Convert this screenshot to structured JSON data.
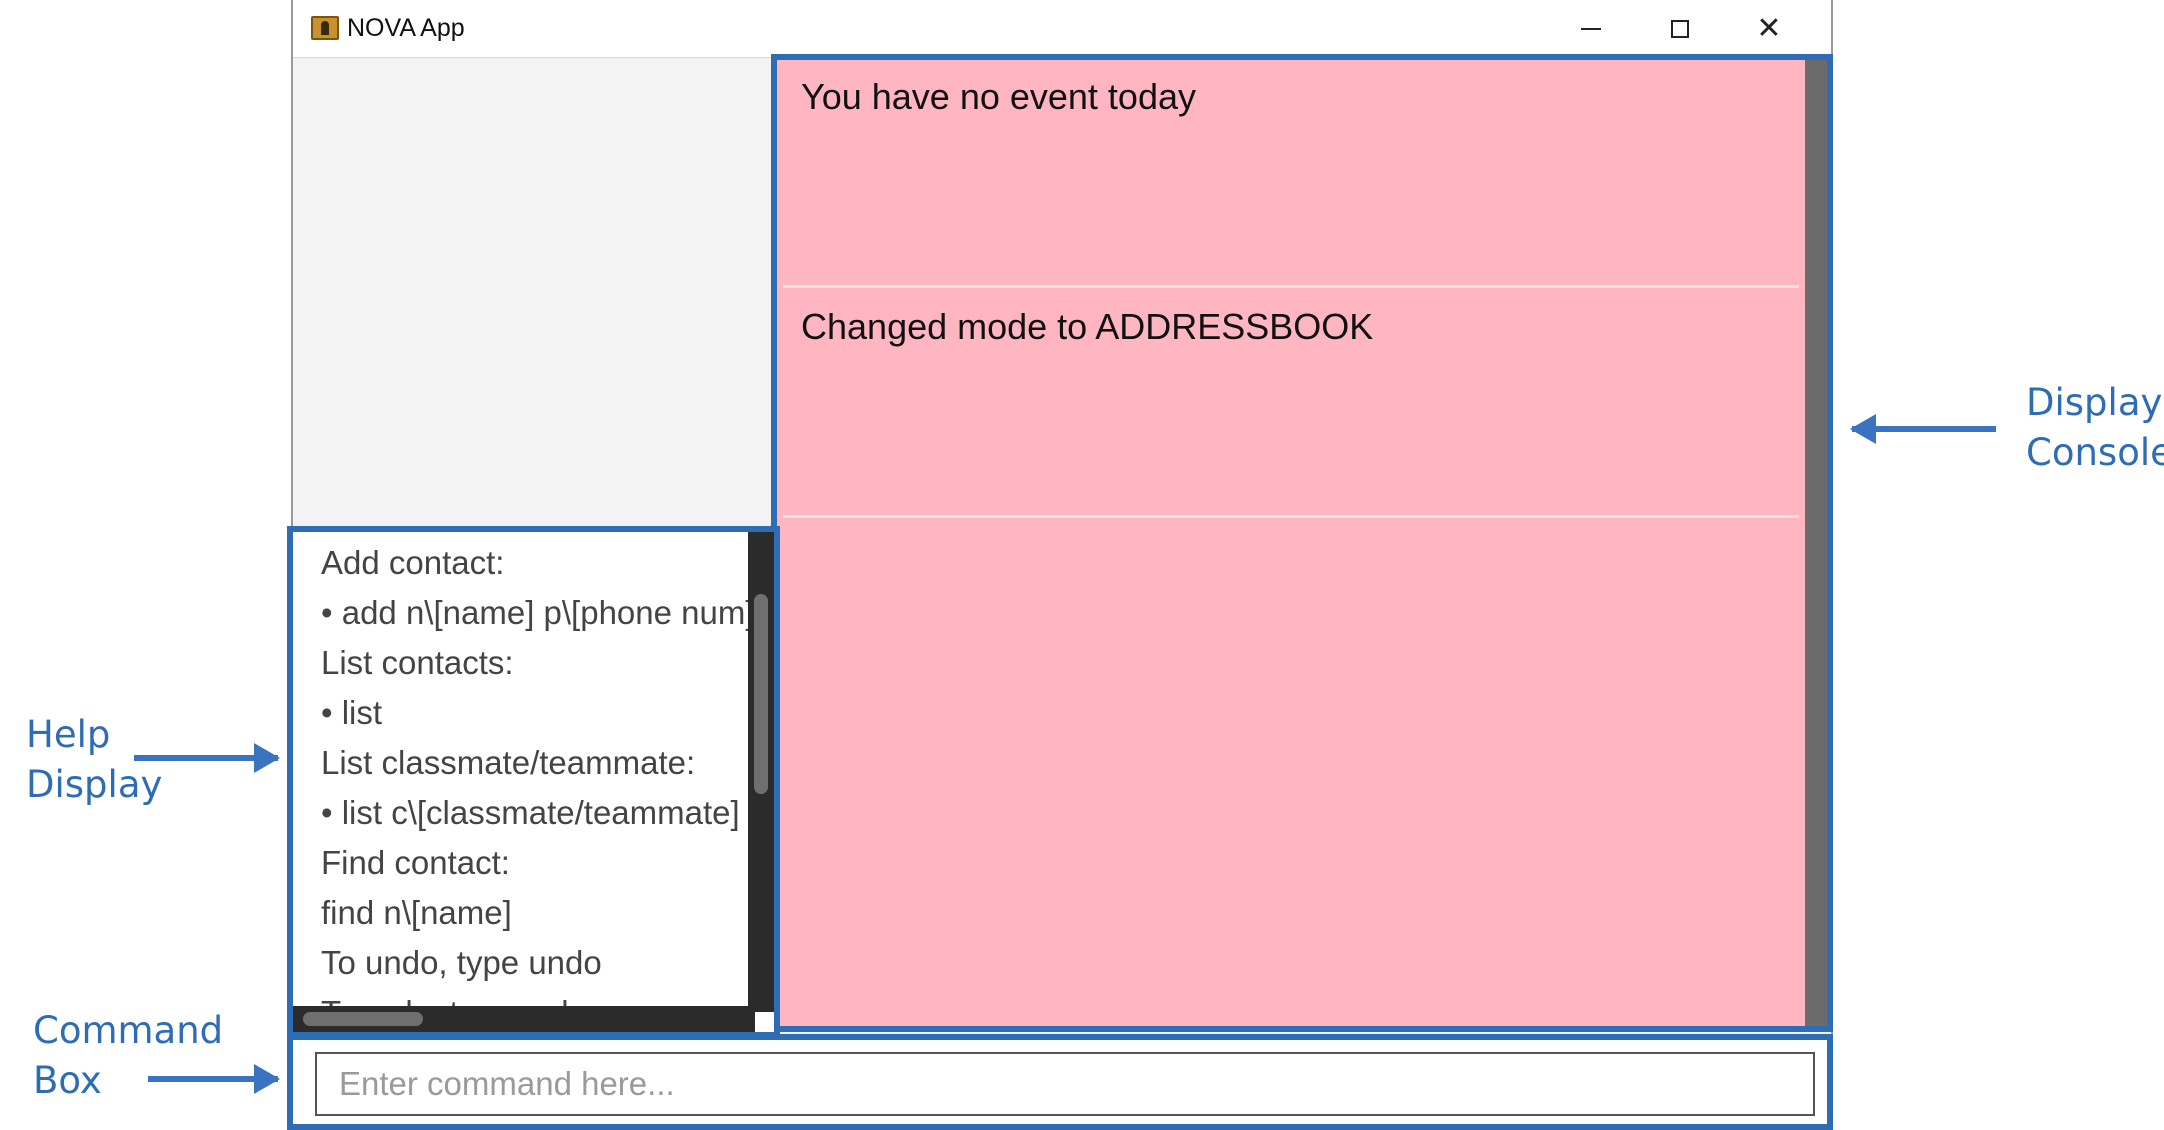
{
  "window": {
    "title": "NOVA App",
    "icon": "address-book-icon",
    "controls": [
      "minimize-icon",
      "maximize-icon",
      "close-icon"
    ]
  },
  "console": {
    "cards": [
      "You have no event today",
      "Changed mode to ADDRESSBOOK"
    ],
    "background": "#ffb6c1"
  },
  "help": {
    "lines": [
      "Add contact:",
      "• add n\\[name] p\\[phone num]",
      "List contacts:",
      "• list",
      "List classmate/teammate:",
      "• list c\\[classmate/teammate]",
      "Find contact:",
      "find n\\[name]",
      "To undo, type undo",
      "To redo, type redo"
    ]
  },
  "command": {
    "placeholder": "Enter command here...",
    "value": ""
  },
  "annotations": {
    "console_label_line1": "Display",
    "console_label_line2": "Console",
    "help_label_line1": "Help",
    "help_label_line2": "Display",
    "command_label_line1": "Command",
    "command_label_line2": "Box",
    "color": "#2e6db4"
  }
}
